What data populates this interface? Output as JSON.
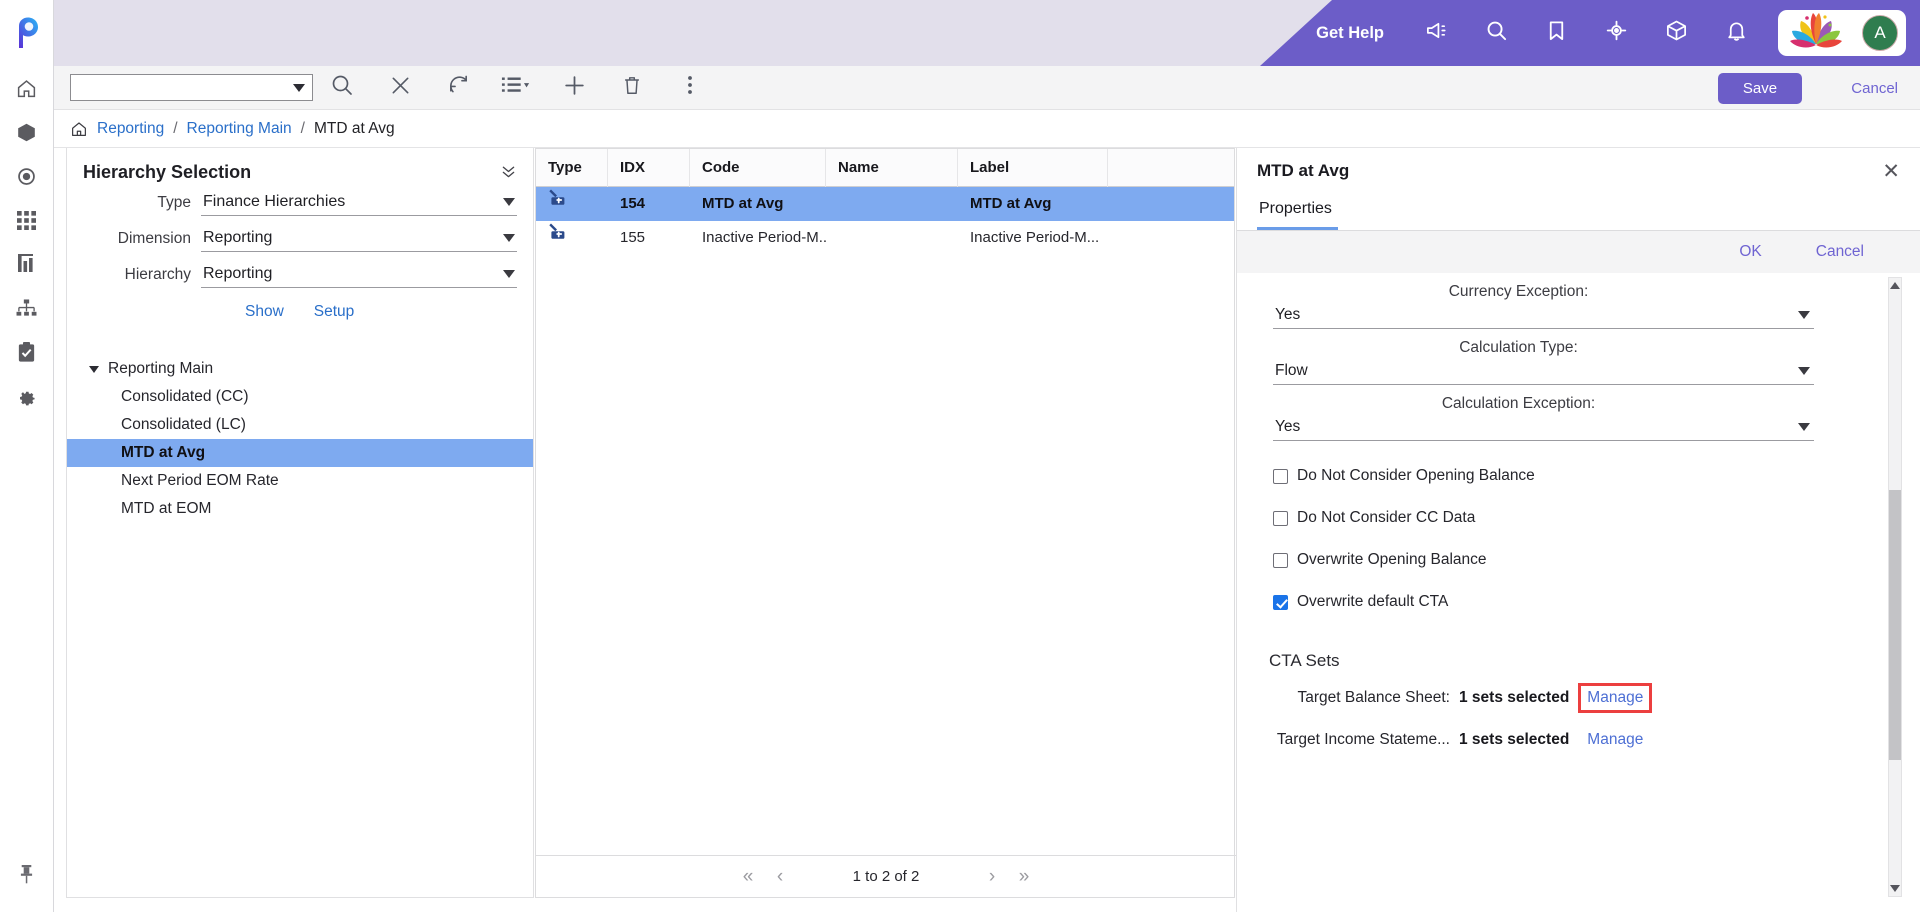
{
  "app": {
    "logo_name": "prophix-logo"
  },
  "left_rail": {
    "items": [
      {
        "name": "home",
        "icon": "home-icon"
      },
      {
        "name": "models",
        "icon": "cube-icon"
      },
      {
        "name": "targets",
        "icon": "target-icon"
      },
      {
        "name": "grid",
        "icon": "grid-icon"
      },
      {
        "name": "reports",
        "icon": "bar-chart-icon"
      },
      {
        "name": "hierarchy",
        "icon": "hierarchy-icon"
      },
      {
        "name": "tasks",
        "icon": "clipboard-check-icon"
      },
      {
        "name": "settings",
        "icon": "gear-icon"
      }
    ],
    "pin": {
      "name": "pin",
      "icon": "pin-icon"
    }
  },
  "header": {
    "get_help": "Get Help",
    "icons": [
      "megaphone-icon",
      "search-icon",
      "bookmark-icon",
      "target-crosshair-icon",
      "cube-icon",
      "bell-icon"
    ],
    "brand_logo": "lotus-logo",
    "avatar_initial": "A",
    "purple": "#6c5dc8",
    "band_bg": "#e2dfeb",
    "avatar_bg": "#2f7d4f"
  },
  "toolbar": {
    "search_select_value": "",
    "buttons": [
      {
        "name": "search-button",
        "icon": "search-icon"
      },
      {
        "name": "clear-button",
        "icon": "close-icon"
      },
      {
        "name": "refresh-button",
        "icon": "refresh-icon"
      },
      {
        "name": "list-view-button",
        "icon": "list-icon"
      },
      {
        "name": "add-button",
        "icon": "plus-icon"
      },
      {
        "name": "delete-button",
        "icon": "trash-icon"
      },
      {
        "name": "more-button",
        "icon": "kebab-menu-icon"
      }
    ],
    "save_label": "Save",
    "cancel_label": "Cancel"
  },
  "breadcrumb": {
    "home_icon": "home-icon",
    "items": [
      {
        "label": "Reporting",
        "link": true
      },
      {
        "label": "Reporting Main",
        "link": true
      },
      {
        "label": "MTD at Avg",
        "link": false
      }
    ],
    "separator": "/"
  },
  "hierarchy_selection": {
    "title": "Hierarchy Selection",
    "collapse_icon": "chevron-double-down-icon",
    "fields": [
      {
        "label": "Type",
        "value": "Finance Hierarchies"
      },
      {
        "label": "Dimension",
        "value": "Reporting"
      },
      {
        "label": "Hierarchy",
        "value": "Reporting"
      }
    ],
    "actions": {
      "show": "Show",
      "setup": "Setup"
    },
    "tree": {
      "root": "Reporting Main",
      "children": [
        {
          "label": "Consolidated (CC)",
          "selected": false
        },
        {
          "label": "Consolidated (LC)",
          "selected": false
        },
        {
          "label": "MTD at Avg",
          "selected": true
        },
        {
          "label": "Next Period EOM Rate",
          "selected": false
        },
        {
          "label": "MTD at EOM",
          "selected": false
        }
      ]
    }
  },
  "grid": {
    "columns": [
      "Type",
      "IDX",
      "Code",
      "Name",
      "Label"
    ],
    "rows": [
      {
        "type_icon": "node-add-icon",
        "idx": "154",
        "code": "MTD at Avg",
        "name": "",
        "label": "MTD at Avg",
        "selected": true
      },
      {
        "type_icon": "node-add-icon",
        "idx": "155",
        "code": "Inactive Period-M...",
        "name": "",
        "label": "Inactive Period-M...",
        "selected": false
      }
    ],
    "pager": {
      "first_icon": "double-chevron-left-icon",
      "prev_icon": "chevron-left-icon",
      "label": "1 to 2 of 2",
      "next_icon": "chevron-right-icon",
      "last_icon": "double-chevron-right-icon"
    }
  },
  "properties": {
    "title": "MTD at Avg",
    "close_icon": "close-icon",
    "tab": "Properties",
    "ok_label": "OK",
    "cancel_label": "Cancel",
    "fields": [
      {
        "label": "Currency Exception:",
        "value": "Yes"
      },
      {
        "label": "Calculation Type:",
        "value": "Flow"
      },
      {
        "label": "Calculation Exception:",
        "value": "Yes"
      }
    ],
    "checkboxes": [
      {
        "label": "Do Not Consider Opening Balance",
        "checked": false
      },
      {
        "label": "Do Not Consider CC Data",
        "checked": false
      },
      {
        "label": "Overwrite Opening Balance",
        "checked": false
      },
      {
        "label": "Overwrite default CTA",
        "checked": true
      }
    ],
    "cta": {
      "title": "CTA Sets",
      "rows": [
        {
          "name": "Target Balance Sheet:",
          "count": "1 sets selected",
          "manage": "Manage",
          "highlighted": true
        },
        {
          "name": "Target Income Stateme...",
          "count": "1 sets selected",
          "manage": "Manage",
          "highlighted": false
        }
      ]
    },
    "highlight_color": "#ec3f3f"
  }
}
